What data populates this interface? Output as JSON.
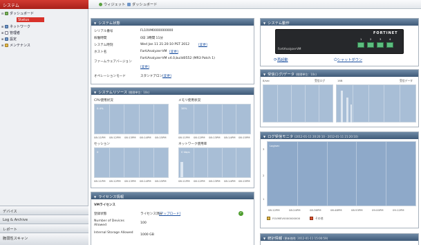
{
  "sidebar": {
    "title": "システム",
    "tree": [
      {
        "label": "ダッシュボード"
      },
      {
        "label": "Status"
      },
      {
        "label": "ネットワーク"
      },
      {
        "label": "管理者"
      },
      {
        "label": "設定"
      },
      {
        "label": "メンテナンス"
      }
    ],
    "accordion": [
      "デバイス",
      "Log & Archive",
      "レポート",
      "脆弱性スキャン"
    ]
  },
  "toolbar": {
    "add": "ウィジェット",
    "dashboard": "ダッシュボード"
  },
  "sysinfo": {
    "title": "システム状態",
    "rows": [
      {
        "label": "シリアル番号",
        "value": "FL10VM0000000000",
        "link": ""
      },
      {
        "label": "稼働時間",
        "value": "0日 3時間 11分",
        "link": ""
      },
      {
        "label": "システム時刻",
        "value": "Wed Jan 11 21:20:10 PST 2012",
        "link": "[変更]"
      },
      {
        "label": "ホスト名",
        "value": "FortiAnalyzer-VM",
        "link": "[変更]"
      },
      {
        "label": "ファームウェアバージョン",
        "value": "FortiAnalyzer-VM v4.0,build0552 (MR3 Patch 1)",
        "link": "[変更]"
      },
      {
        "label": "オペレーションモード",
        "value": "スタンドアロン",
        "link": "[変更]"
      }
    ]
  },
  "resources": {
    "title": "システムリソース",
    "title_note": "(間隔単位：10s)",
    "charts": [
      {
        "label": "CPU使用状況",
        "sub": "0.4%",
        "ticks": [
          "08:11PM",
          "08:12PM",
          "08:13PM",
          "08:14PM",
          "08:15PM"
        ]
      },
      {
        "label": "メモリ使用状況",
        "sub": "38%",
        "ticks": [
          "08:11PM",
          "08:12PM",
          "08:13PM",
          "08:14PM",
          "08:15PM"
        ]
      },
      {
        "label": "セッション",
        "sub": "0",
        "ticks": [
          "08:11PM",
          "08:12PM",
          "08:13PM",
          "08:14PM",
          "08:15PM"
        ]
      },
      {
        "label": "ネットワーク使用率",
        "sub": "0 kbps",
        "ticks": [
          "08:11PM",
          "08:12PM",
          "08:13PM",
          "08:14PM",
          "08:15PM"
        ]
      }
    ]
  },
  "license": {
    "title": "ライセンス情報",
    "section": "VMライセンス",
    "rows": [
      {
        "label": "登録状態",
        "value": "ライセンス済み",
        "link": "[アップロード]"
      },
      {
        "label": "Number of Devices Allowed",
        "value": "100",
        "link": ""
      },
      {
        "label": "Internal Storage Allowed",
        "value": "1000 GB",
        "link": ""
      }
    ]
  },
  "sysop": {
    "title": "システム動作",
    "brand": "FORTINET",
    "device": "FortiAnalyzer-VM",
    "ports": [
      "1",
      "2",
      "3",
      "4"
    ],
    "restart": "再起動",
    "shutdown": "シャットダウン"
  },
  "lograte": {
    "title": "受信ログ/データ",
    "title_note": "(間隔単位：10s)",
    "unit": "8/sec",
    "legend": [
      "受信ログ",
      "16B",
      "受信データ"
    ]
  },
  "logmon": {
    "title": "ログ受信モニタ",
    "range": "(2012-01-11 20:20:10 - 2012-01-11 21:20:10)",
    "y_ticks": [
      "3",
      "2",
      "1"
    ],
    "x_ticks": [
      "08:12PM",
      "08:24PM",
      "08:36PM",
      "08:48PM",
      "08:53PM",
      "09:00PM",
      "09:12PM"
    ],
    "inner_label": "Log/sec",
    "legend": [
      {
        "name": "FGVMEV0000000000",
        "color": "#e2b84a"
      },
      {
        "name": "その他",
        "color": "#d9542f"
      }
    ]
  },
  "stats": {
    "title": "統計情報",
    "title_note": "(更新間隔: 2012-01-11 15:00:59)"
  }
}
